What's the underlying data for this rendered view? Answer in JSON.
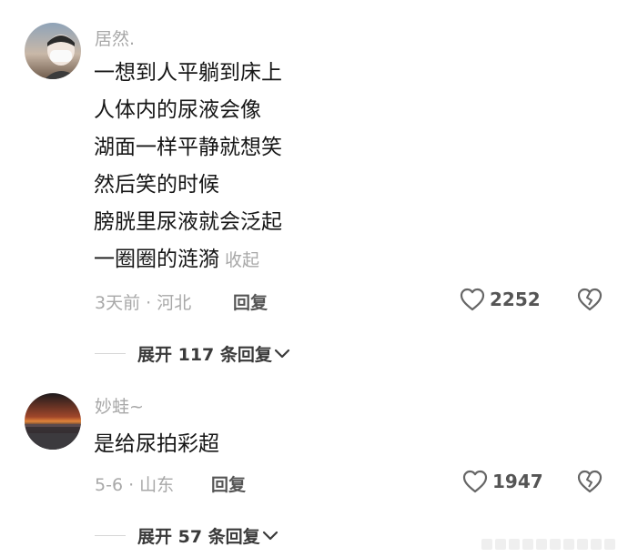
{
  "comments": [
    {
      "username": "居然.",
      "lines": [
        "一想到人平躺到床上",
        "人体内的尿液会像",
        "湖面一样平静就想笑",
        "然后笑的时候",
        "膀胱里尿液就会泛起",
        "一圈圈的涟漪"
      ],
      "collapse_label": "收起",
      "meta": "3天前 · 河北",
      "reply_label": "回复",
      "like_count": "2252",
      "expand_label": "展开 117 条回复"
    },
    {
      "username": "妙蛙~",
      "lines": [
        "是给尿拍彩超"
      ],
      "meta": "5-6 · 山东",
      "reply_label": "回复",
      "like_count": "1947",
      "expand_label": "展开 57 条回复"
    }
  ],
  "icons": {
    "like": "heart-outline-icon",
    "dislike": "broken-heart-icon",
    "expand": "chevron-down-icon"
  },
  "colors": {
    "secondary_text": "#a8a8a8",
    "primary_text": "#161616",
    "action_text": "#555555"
  }
}
